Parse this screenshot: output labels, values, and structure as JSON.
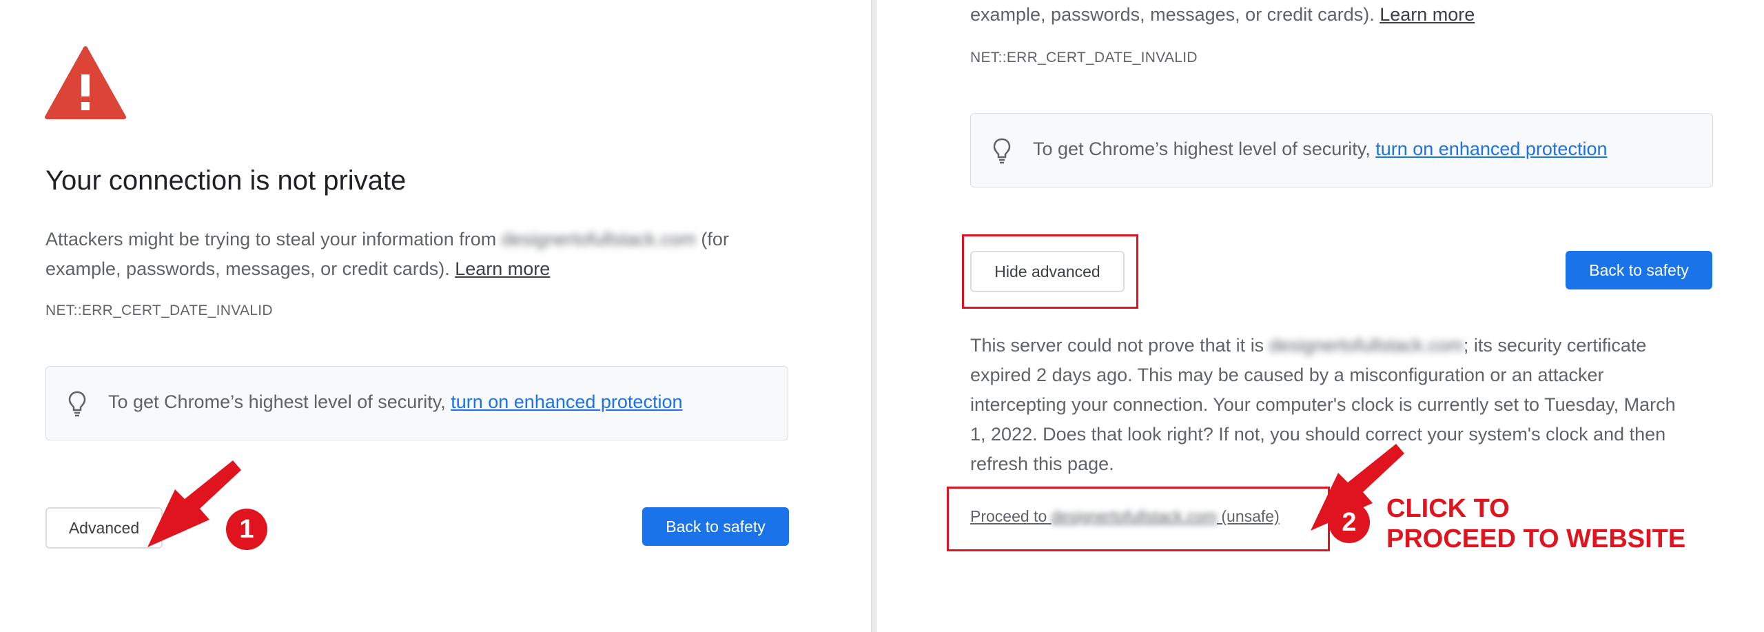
{
  "left": {
    "title": "Your connection is not private",
    "body_line1_prefix": "Attackers might be trying to steal your information from ",
    "blurred_domain": "designertofullstack.com",
    "body_line1_suffix": " (for",
    "body_line2": "example, passwords, messages, or credit cards). ",
    "learn_more": "Learn more",
    "error_code": "NET::ERR_CERT_DATE_INVALID",
    "enhanced_prefix": "To get Chrome’s highest level of security, ",
    "enhanced_link": "turn on enhanced protection",
    "advanced_button": "Advanced",
    "back_button": "Back to safety",
    "step_badge": "1"
  },
  "right": {
    "top_line": "example, passwords, messages, or credit cards). ",
    "learn_more": "Learn more",
    "error_code": "NET::ERR_CERT_DATE_INVALID",
    "enhanced_prefix": "To get Chrome’s highest level of security, ",
    "enhanced_link": "turn on enhanced protection",
    "hide_advanced_button": "Hide advanced",
    "back_button": "Back to safety",
    "detail_line1_prefix": "This server could not prove that it is ",
    "blurred_domain": "designertofullstack.com",
    "detail_line1_suffix": "; its security certificate",
    "detail_line2": "expired 2 days ago. This may be caused by a misconfiguration or an attacker",
    "detail_line3": "intercepting your connection. Your computer's clock is currently set to Tuesday, March",
    "detail_line4": "1, 2022. Does that look right? If not, you should correct your system's clock and then",
    "detail_line5": "refresh this page.",
    "proceed_prefix": "Proceed to ",
    "proceed_domain": "designertofullstack.com",
    "proceed_suffix": " (unsafe)",
    "step_badge": "2",
    "cta_line1": "CLICK TO",
    "cta_line2": "PROCEED TO WEBSITE"
  },
  "colors": {
    "accent_blue": "#1a73e8",
    "warning_red": "#db4437",
    "annotation_red": "#e0141e"
  }
}
